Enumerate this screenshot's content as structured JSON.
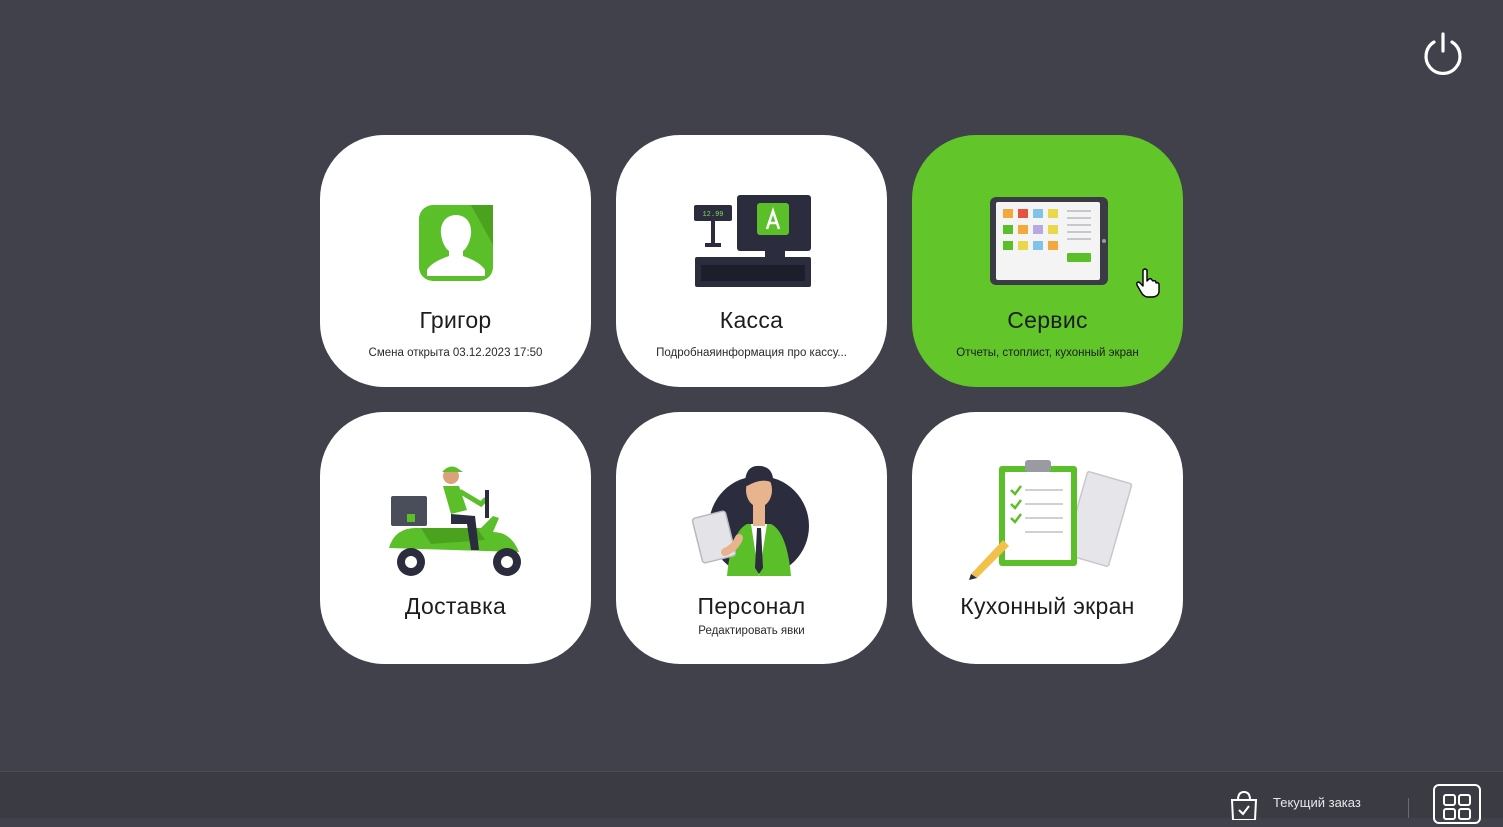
{
  "tiles": [
    {
      "id": "user",
      "title": "Григор",
      "subtitle": "Смена открыта  03.12.2023  17:50",
      "icon": "user-avatar-icon"
    },
    {
      "id": "cashier",
      "title": "Касса",
      "subtitle": "Подробнаяинформация про кассу...",
      "icon": "cash-register-icon"
    },
    {
      "id": "service",
      "title": "Сервис",
      "subtitle": "Отчеты, стоплист, кухонный экран",
      "icon": "tablet-icon",
      "active": true
    },
    {
      "id": "delivery",
      "title": "Доставка",
      "subtitle": "",
      "icon": "scooter-courier-icon"
    },
    {
      "id": "staff",
      "title": "Персонал",
      "subtitle": "Редактировать явки",
      "icon": "staff-person-icon"
    },
    {
      "id": "kitchen",
      "title": "Кухонный экран",
      "subtitle": "",
      "icon": "clipboard-checklist-icon"
    }
  ],
  "footer": {
    "current_order_label": "Текущий заказ"
  },
  "colors": {
    "background": "#40414a",
    "accent": "#62c52a",
    "tile": "#ffffff"
  }
}
